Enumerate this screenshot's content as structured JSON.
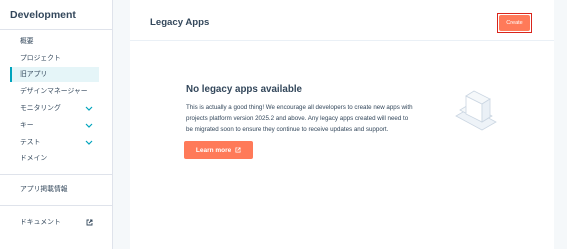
{
  "sidebar": {
    "title": "Development",
    "items": [
      {
        "label": "概要",
        "icon": ""
      },
      {
        "label": "プロジェクト",
        "icon": ""
      },
      {
        "label": "旧アプリ",
        "icon": "",
        "active": true
      },
      {
        "label": "デザインマネージャー",
        "icon": ""
      },
      {
        "label": "モニタリング",
        "icon": "chevron-down-icon"
      },
      {
        "label": "キー",
        "icon": "chevron-down-icon"
      },
      {
        "label": "テスト",
        "icon": "chevron-down-icon"
      },
      {
        "label": "ドメイン",
        "icon": ""
      },
      {
        "label": "アプリ掲載情報",
        "icon": ""
      },
      {
        "label": "ドキュメント",
        "icon": "external-link-icon"
      }
    ]
  },
  "header": {
    "title": "Legacy Apps",
    "create_label": "Create"
  },
  "empty_state": {
    "title": "No legacy apps available",
    "body_lines": [
      "This is actually a good thing! We encourage all developers to create new apps with",
      "projects platform version 2025.2 and above. Any legacy apps created will need to",
      "be migrated soon to ensure they continue to receive updates and support."
    ],
    "button_label": "Learn more",
    "button_icon": "external-link-icon",
    "illustration": "empty-stack-illustration"
  },
  "colors": {
    "accent": "#ff7a59",
    "active_bg": "#e5f5f8",
    "active_border": "#00a4bd",
    "chevron": "#00a4bd",
    "highlight": "#d9251c",
    "text": "#33475b"
  }
}
